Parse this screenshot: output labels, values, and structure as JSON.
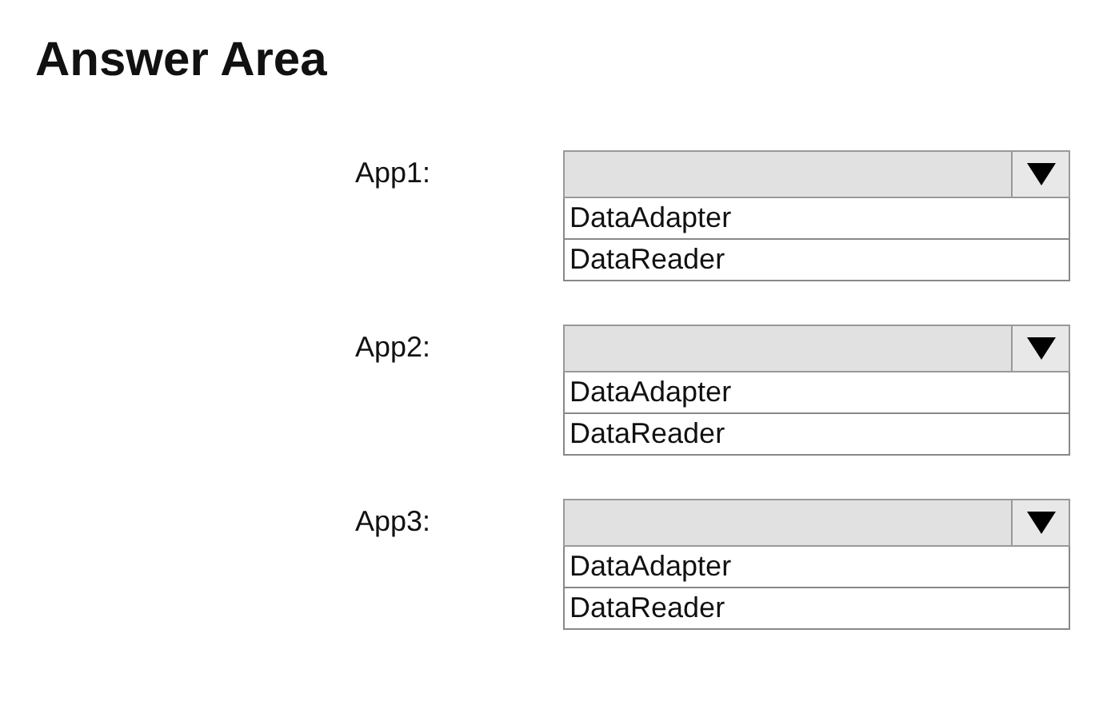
{
  "title": "Answer Area",
  "questions": [
    {
      "label": "App1:",
      "options": [
        "DataAdapter",
        "DataReader"
      ]
    },
    {
      "label": "App2:",
      "options": [
        "DataAdapter",
        "DataReader"
      ]
    },
    {
      "label": "App3:",
      "options": [
        "DataAdapter",
        "DataReader"
      ]
    }
  ]
}
